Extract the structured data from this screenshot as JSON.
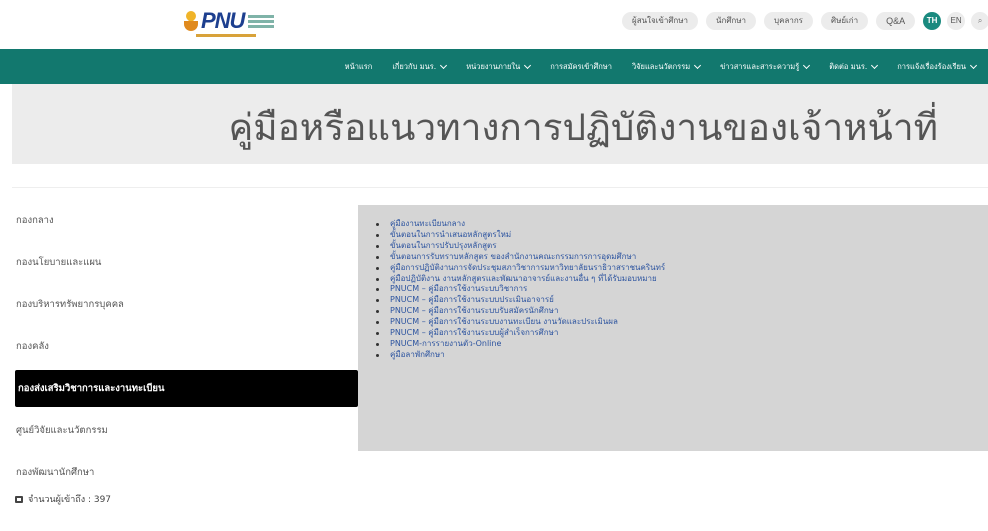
{
  "header": {
    "logo_text": "PNU",
    "top_links": [
      "ผู้สนใจเข้าศึกษา",
      "นักศึกษา",
      "บุคลากร",
      "ศิษย์เก่า",
      "Q&A"
    ],
    "lang_th": "TH",
    "lang_en": "EN",
    "search_icon": "⌕"
  },
  "nav": {
    "items": [
      {
        "label": "หน้าแรก",
        "has_dropdown": false
      },
      {
        "label": "เกี่ยวกับ มนร.",
        "has_dropdown": true
      },
      {
        "label": "หน่วยงานภายใน",
        "has_dropdown": true
      },
      {
        "label": "การสมัครเข้าศึกษา",
        "has_dropdown": false
      },
      {
        "label": "วิจัยและนวัตกรรม",
        "has_dropdown": true
      },
      {
        "label": "ข่าวสารและสาระความรู้",
        "has_dropdown": true
      },
      {
        "label": "ติดต่อ มนร.",
        "has_dropdown": true
      },
      {
        "label": "การแจ้งเรื่องร้องเรียน",
        "has_dropdown": true
      }
    ]
  },
  "page": {
    "title": "คู่มือหรือแนวทางการปฏิบัติงานของเจ้าหน้าที่"
  },
  "sidebar": {
    "items": [
      {
        "label": "กองกลาง",
        "active": false
      },
      {
        "label": "กองนโยบายและแผน",
        "active": false
      },
      {
        "label": "กองบริหารทรัพยากรบุคคล",
        "active": false
      },
      {
        "label": "กองคลัง",
        "active": false
      },
      {
        "label": "กองส่งเสริมวิชาการและงานทะเบียน",
        "active": true
      },
      {
        "label": "ศูนย์วิจัยและนวัตกรรม",
        "active": false
      },
      {
        "label": "กองพัฒนานักศึกษา",
        "active": false
      }
    ],
    "visitors": "จำนวนผู้เข้าถึง : 397"
  },
  "content": {
    "links": [
      "คู่มืองานทะเบียนกลาง",
      "ขั้นตอนในการนำเสนอหลักสูตรใหม่",
      "ขั้นตอนในการปรับปรุงหลักสูตร",
      "ขั้นตอนการรับทราบหลักสูตร ของสำนักงานคณะกรรมการการอุดมศึกษา",
      "คู่มือการปฏิบัติงานการจัดประชุมสภาวิชาการมหาวิทยาลัยนราธิวาสราชนครินทร์",
      "คู่มือปฏิบัติงาน งานหลักสูตรและพัฒนาอาจารย์และงานอื่น ๆ ที่ได้รับมอบหมาย",
      "PNUCM – คู่มือการใช้งานระบบวิชาการ",
      "PNUCM – คู่มือการใช้งานระบบประเมินอาจารย์",
      "PNUCM – คู่มือการใช้งานระบบรับสมัครนักศึกษา",
      "PNUCM – คู่มือการใช้งานระบบงานทะเบียน งานวัดและประเมินผล",
      "PNUCM – คู่มือการใช้งานระบบผู้สำเร็จการศึกษา",
      "PNUCM-การรายงานตัว-Online",
      "คู่มือลาพักศึกษา"
    ]
  }
}
